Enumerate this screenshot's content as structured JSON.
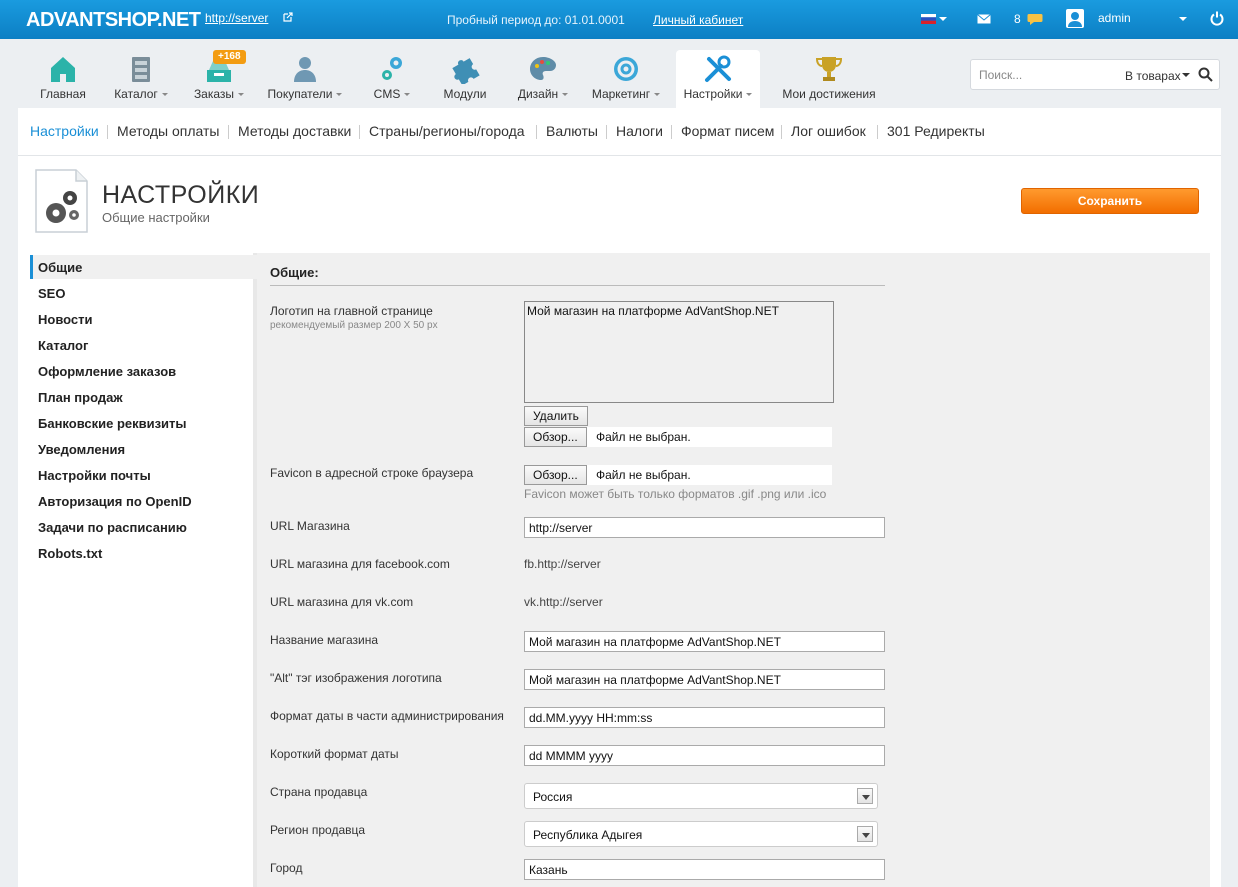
{
  "topbar": {
    "logo": "ADVANTSHOP.NET",
    "server_link": "http://server",
    "trial_text": "Пробный период до: 01.01.0001",
    "cabinet_link": "Личный кабинет",
    "messages_count": "8",
    "username": "admin"
  },
  "nav": {
    "items": [
      {
        "label": "Главная",
        "icon": "home-icon"
      },
      {
        "label": "Каталог",
        "icon": "catalog-icon"
      },
      {
        "label": "Заказы",
        "icon": "orders-icon"
      },
      {
        "label": "Покупатели",
        "icon": "customers-icon"
      },
      {
        "label": "CMS",
        "icon": "cms-gears-icon"
      },
      {
        "label": "Модули",
        "icon": "puzzle-icon"
      },
      {
        "label": "Дизайн",
        "icon": "palette-icon"
      },
      {
        "label": "Маркетинг",
        "icon": "target-icon"
      },
      {
        "label": "Настройки",
        "icon": "tools-icon"
      },
      {
        "label": "Мои достижения",
        "icon": "trophy-icon"
      }
    ],
    "orders_badge": "+168",
    "active": "Настройки"
  },
  "search": {
    "placeholder": "Поиск...",
    "scope": "В товарах"
  },
  "subnav": {
    "items": [
      "Настройки",
      "Методы оплаты",
      "Методы доставки",
      "Страны/регионы/города",
      "Валюты",
      "Налоги",
      "Формат писем",
      "Лог ошибок",
      "301 Редиректы"
    ],
    "active": "Настройки"
  },
  "page": {
    "title": "НАСТРОЙКИ",
    "subtitle": "Общие настройки",
    "save_label": "Сохранить"
  },
  "left_menu": {
    "items": [
      "Общие",
      "SEO",
      "Новости",
      "Каталог",
      "Оформление заказов",
      "План продаж",
      "Банковские реквизиты",
      "Уведомления",
      "Настройки почты",
      "Авторизация по OpenID",
      "Задачи по расписанию",
      "Robots.txt"
    ],
    "active": "Общие"
  },
  "form": {
    "section_title": "Общие:",
    "logo_label": "Логотип на главной странице",
    "logo_hint": "рекомендуемый размер 200 Х 50 px",
    "logo_value": "Мой магазин на платформе AdVantShop.NET",
    "delete_label": "Удалить",
    "browse_label": "Обзор...",
    "no_file": "Файл не выбран.",
    "favicon_label": "Favicon в адресной строке браузера",
    "favicon_note": "Favicon может быть только форматов .gif .png или .ico",
    "url_label": "URL Магазина",
    "url_value": "http://server",
    "fb_label": "URL магазина для facebook.com",
    "fb_value": "fb.http://server",
    "vk_label": "URL магазина для vk.com",
    "vk_value": "vk.http://server",
    "shop_name_label": "Название магазина",
    "shop_name_value": "Мой магазин на платформе AdVantShop.NET",
    "alt_label": "\"Alt\" тэг изображения логотипа",
    "alt_value": "Мой магазин на платформе AdVantShop.NET",
    "admin_date_label": "Формат даты в части администрирования",
    "admin_date_value": "dd.MM.yyyy HH:mm:ss",
    "short_date_label": "Короткий формат даты",
    "short_date_value": "dd MMMM yyyy",
    "country_label": "Страна продавца",
    "country_value": "Россия",
    "region_label": "Регион продавца",
    "region_value": "Республика Адыгея",
    "city_label": "Город",
    "city_value": "Казань"
  },
  "colors": {
    "topbar": "#1a9bdf",
    "accent": "#1a8fd6",
    "save_button": "#f26e00",
    "badge": "#f39c12"
  }
}
